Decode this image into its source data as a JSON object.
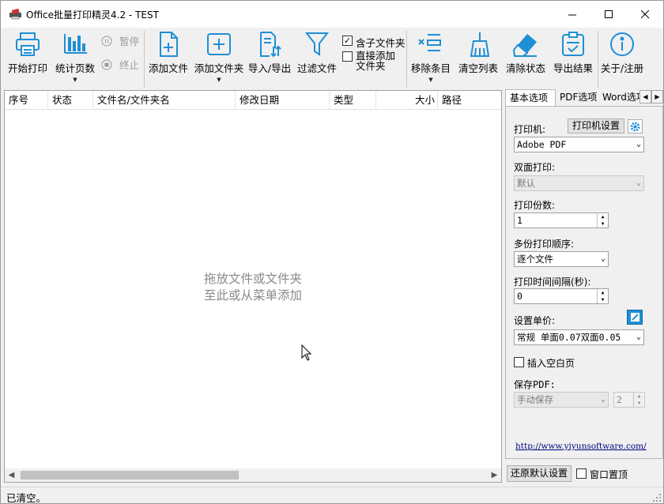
{
  "window": {
    "title": "Office批量打印精灵4.2 - TEST"
  },
  "toolbar": {
    "start_print": "开始打印",
    "count_pages": "统计页数",
    "pause": "暂停",
    "stop": "终止",
    "add_file": "添加文件",
    "add_folder": "添加文件夹",
    "import_export": "导入/导出",
    "filter_files": "过滤文件",
    "include_subfolders": "含子文件夹",
    "include_subfolders_checked": true,
    "add_folder_directly_line1": "直接添加",
    "add_folder_directly_line2": "文件夹",
    "add_folder_directly_checked": false,
    "remove_items": "移除条目",
    "clear_list": "清空列表",
    "clear_status": "清除状态",
    "export_results": "导出结果",
    "about_register": "关于/注册",
    "accent_color": "#1f8fd6"
  },
  "file_list": {
    "columns": [
      "序号",
      "状态",
      "文件名/文件夹名",
      "修改日期",
      "类型",
      "大小",
      "路径"
    ],
    "placeholder_line1": "拖放文件或文件夹",
    "placeholder_line2": "至此或从菜单添加"
  },
  "tabs": [
    "基本选项",
    "PDF选项",
    "Word选项"
  ],
  "options": {
    "printer_label": "打印机:",
    "printer_settings_button": "打印机设置",
    "printer_value": "Adobe PDF",
    "duplex_label": "双面打印:",
    "duplex_value": "默认",
    "copies_label": "打印份数:",
    "copies_value": "1",
    "order_label": "多份打印顺序:",
    "order_value": "逐个文件",
    "interval_label": "打印时间间隔(秒):",
    "interval_value": "0",
    "unit_price_label": "设置单价:",
    "unit_price_value": "常规 单面0.07双面0.05",
    "insert_blank_label": "插入空白页",
    "insert_blank_checked": false,
    "save_pdf_label": "保存PDF:",
    "save_pdf_value": "手动保存",
    "save_pdf_count": "2",
    "website": "http://www.yiyunsoftware.com/"
  },
  "bottom": {
    "restore_defaults": "还原默认设置",
    "window_on_top": "窗口置顶",
    "window_on_top_checked": false
  },
  "status_bar": {
    "text": "已清空。"
  }
}
